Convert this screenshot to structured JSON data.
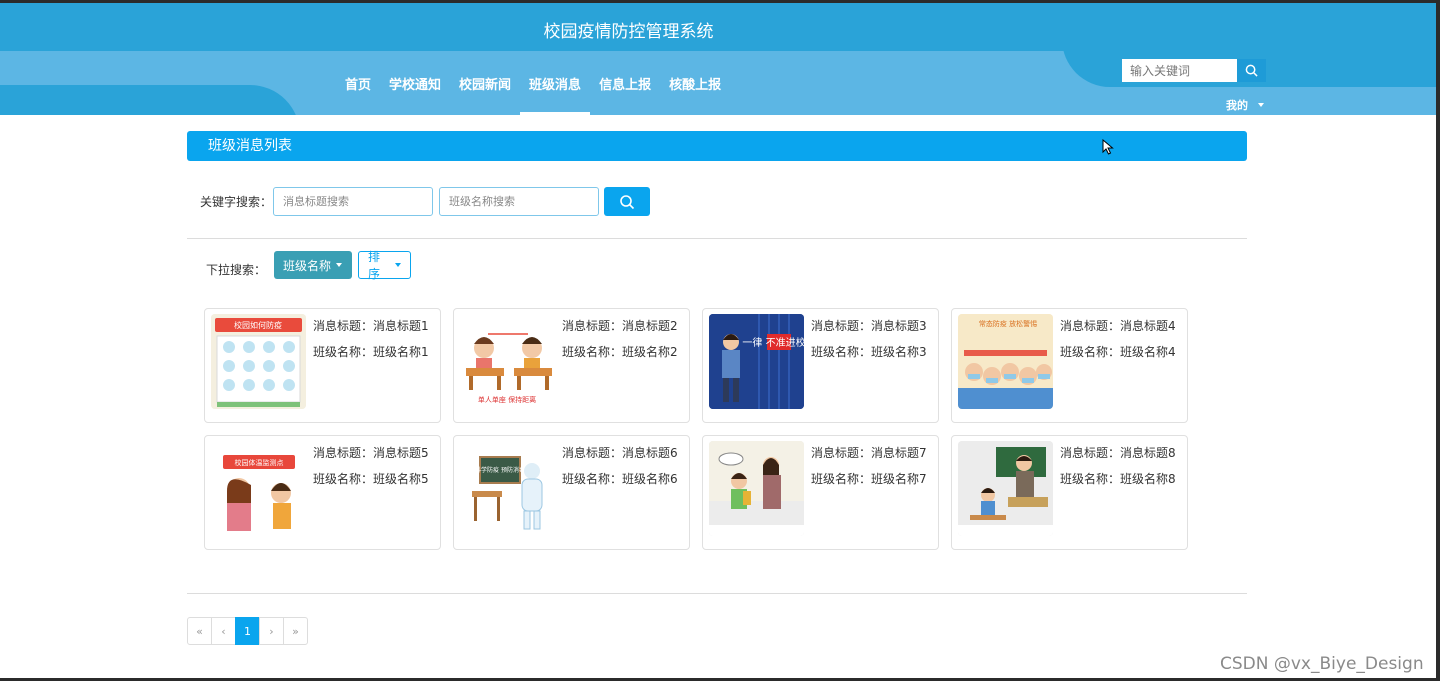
{
  "header": {
    "site_title": "校园疫情防控管理系统",
    "nav": [
      "首页",
      "学校通知",
      "校园新闻",
      "班级消息",
      "信息上报",
      "核酸上报"
    ],
    "active_nav": "班级消息",
    "search_placeholder": "输入关键词",
    "mine_label": "我的"
  },
  "section": {
    "title": "班级消息列表"
  },
  "search": {
    "label": "关键字搜索：",
    "title_placeholder": "消息标题搜索",
    "class_placeholder": "班级名称搜索"
  },
  "dropdown": {
    "label": "下拉搜索：",
    "class_button": "班级名称",
    "sort_button": "排序"
  },
  "cards": [
    {
      "title": "消息标题：消息标题1",
      "cls": "班级名称：班级名称1",
      "img_caption": "校园如何防疫"
    },
    {
      "title": "消息标题：消息标题2",
      "cls": "班级名称：班级名称2",
      "img_caption": "单人单座  保持距离"
    },
    {
      "title": "消息标题：消息标题3",
      "cls": "班级名称：班级名称3",
      "img_caption": "一律 不准进校门"
    },
    {
      "title": "消息标题：消息标题4",
      "cls": "班级名称：班级名称4",
      "img_caption": "常态防疫 放松警惕"
    },
    {
      "title": "消息标题：消息标题5",
      "cls": "班级名称：班级名称5",
      "img_caption": "校园体温监测点"
    },
    {
      "title": "消息标题：消息标题6",
      "cls": "班级名称：班级名称6",
      "img_caption": "科学防疫 预防消毒"
    },
    {
      "title": "消息标题：消息标题7",
      "cls": "班级名称：班级名称7",
      "img_caption": ""
    },
    {
      "title": "消息标题：消息标题8",
      "cls": "班级名称：班级名称8",
      "img_caption": ""
    }
  ],
  "pagination": {
    "first": "«",
    "prev": "‹",
    "current": "1",
    "next": "›",
    "last": "»"
  },
  "watermark": "CSDN @vx_Biye_Design",
  "colors": {
    "header": "#2aa3d8",
    "nav": "#5cb6e4",
    "accent": "#0aa5ee",
    "filter_button": "#3a9fb4"
  }
}
